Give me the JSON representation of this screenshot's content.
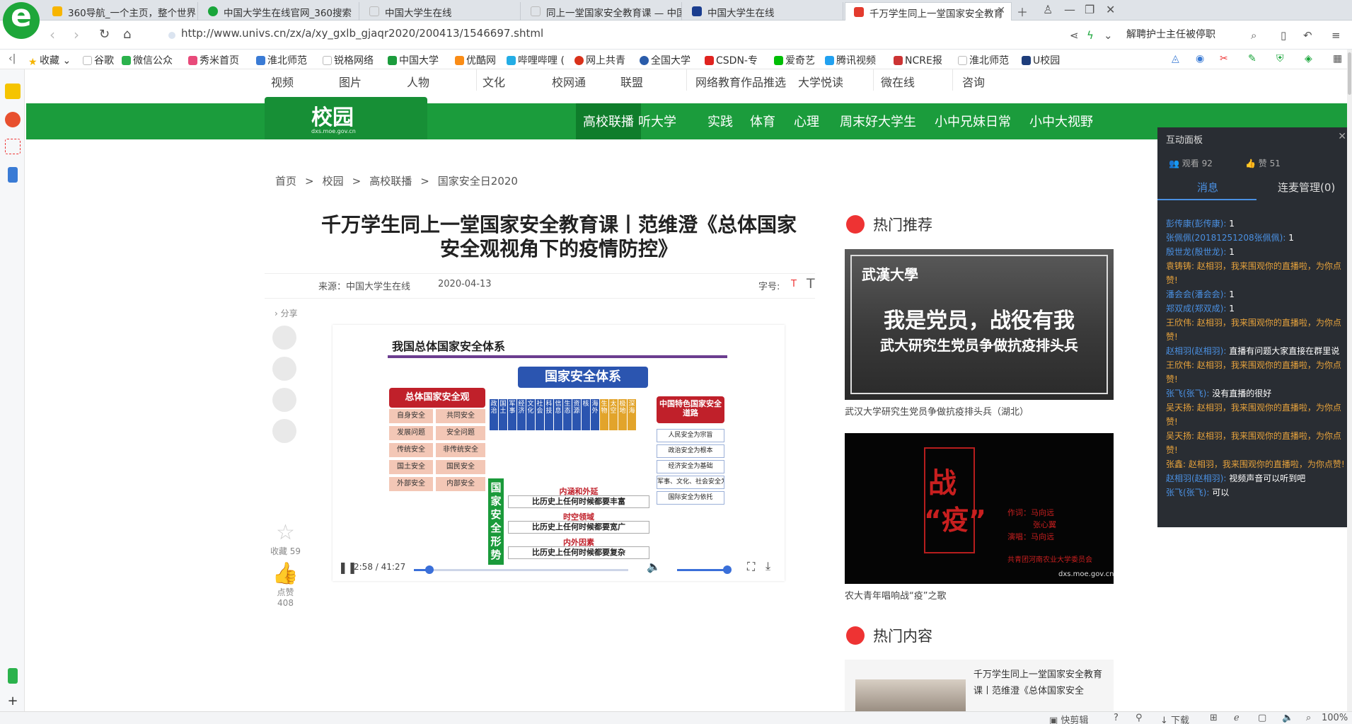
{
  "tabs": [
    {
      "title": "360导航_一个主页，整个世界",
      "color": "#f7b500"
    },
    {
      "title": "中国大学生在线官网_360搜索",
      "color": "#19a53a"
    },
    {
      "title": "中国大学生在线",
      "color": "#bbbbbb"
    },
    {
      "title": "同上一堂国家安全教育课 — 中国",
      "color": "#bbbbbb"
    },
    {
      "title": "中国大学生在线",
      "color": "#1a3d8f"
    },
    {
      "title": "千万学生同上一堂国家安全教育",
      "color": "#e33b2e"
    }
  ],
  "address": {
    "url": "http://www.univs.cn/zx/a/xy_gxlb_gjaqr2020/200413/1546697.shtml",
    "search": "解聘护士主任被停职"
  },
  "bookmarks": [
    "收藏",
    "谷歌",
    "微信公众",
    "秀米首页",
    "淮北师范",
    "锐格网络",
    "中国大学",
    "优酷网",
    "哔哩哔哩 (",
    "网上共青",
    "全国大学",
    "CSDN-专",
    "爱奇艺",
    "腾讯视频",
    "NCRE报",
    "淮北师范",
    "U校园"
  ],
  "site": {
    "topnav": [
      "视频",
      "图片",
      "人物",
      "文化",
      "校网通",
      "联盟",
      "网络教育作品推选",
      "大学悦读",
      "微在线",
      "咨询"
    ],
    "campus": {
      "title": "校园",
      "url": "dxs.moe.gov.cn"
    },
    "greennav": [
      "高校联播",
      "听大学",
      "实践",
      "体育",
      "心理",
      "周末好大学生",
      "小中兄妹日常",
      "小中大视野"
    ]
  },
  "breadcrumb": [
    "首页",
    ">",
    "校园",
    ">",
    "高校联播",
    ">",
    "国家安全日2020"
  ],
  "article": {
    "title": "千万学生同上一堂国家安全教育课丨范维澄《总体国家安全观视角下的疫情防控》",
    "source": "来源：中国大学生在线",
    "date": "2020-04-13",
    "font_label": "字号:",
    "share_label": "分享",
    "fav_label": "收藏 59",
    "like_label": "点赞",
    "like_count": "408"
  },
  "video": {
    "time": "2:58 / 41:27",
    "progress": 0.072,
    "volume": 1.0,
    "slide": {
      "heading": "我国总体国家安全体系",
      "system": "国家安全体系",
      "left_head": "总体国家安全观",
      "left_pairs": [
        [
          "自身安全",
          "共同安全"
        ],
        [
          "发展问题",
          "安全问题"
        ],
        [
          "传统安全",
          "非传统安全"
        ],
        [
          "国土安全",
          "国民安全"
        ],
        [
          "外部安全",
          "内部安全"
        ]
      ],
      "cols": [
        "政治",
        "国土",
        "军事",
        "经济",
        "文化",
        "社会",
        "科技",
        "信息",
        "生态",
        "资源",
        "核",
        "海外",
        "生物",
        "太空",
        "极地",
        "深海"
      ],
      "right_head": "中国特色国家安全道路",
      "right_items": [
        "人民安全为宗旨",
        "政治安全为根本",
        "经济安全为基础",
        "军事、文化、社会安全为保障",
        "国际安全为依托"
      ],
      "situation": "国家安全形势",
      "mid": [
        [
          "内涵和外延",
          "比历史上任何时候都要丰富"
        ],
        [
          "时空领域",
          "比历史上任何时候都要宽广"
        ],
        [
          "内外因素",
          "比历史上任何时候都要复杂"
        ]
      ]
    }
  },
  "hot": {
    "title": "热门推荐",
    "items": [
      {
        "caption": "武汉大学研究生党员争做抗疫排头兵（湖北）",
        "uni": "武漢大學",
        "l1": "我是党员，战役有我",
        "l2": "武大研究生党员争做抗疫排头兵"
      },
      {
        "caption": "农大青年唱响战“疫”之歌",
        "big1": "战",
        "big2": "“疫”",
        "credits": [
          "作词：马向远",
          "张心翼",
          "演唱：马向远"
        ],
        "org": "共青团河南农业大学委员会",
        "url": "dxs.moe.gov.cn"
      }
    ]
  },
  "hot_content": {
    "title": "热门内容",
    "text": "千万学生同上一堂国家安全教育课丨范维澄《总体国家安全"
  },
  "panel": {
    "title": "互动面板",
    "viewers": "观看 92",
    "likes": "赞 51",
    "tab_msg": "消息",
    "tab_mic": "连麦管理(0)",
    "messages": [
      {
        "name": "彭传康(彭传康):",
        "text": "1",
        "o": false
      },
      {
        "name": "张佩佩(20181251208张佩佩):",
        "text": "1",
        "o": false
      },
      {
        "name": "殷世龙(殷世龙):",
        "text": "1",
        "o": false
      },
      {
        "name": "袁铸铸:",
        "text": "赵相羽，我来围观你的直播啦，为你点赞!",
        "o": true
      },
      {
        "name": "潘会会(潘会会):",
        "text": "1",
        "o": false
      },
      {
        "name": "郑双成(郑双成):",
        "text": "1",
        "o": false
      },
      {
        "name": "王欣伟:",
        "text": "赵相羽，我来围观你的直播啦，为你点赞!",
        "o": true
      },
      {
        "name": "赵相羽(赵相羽):",
        "text": "直播有问题大家直接在群里说",
        "o": false
      },
      {
        "name": "王欣伟:",
        "text": "赵相羽，我来围观你的直播啦，为你点赞!",
        "o": true
      },
      {
        "name": "张飞(张飞):",
        "text": "没有直播的很好",
        "o": false
      },
      {
        "name": "吴天扬:",
        "text": "赵相羽，我来围观你的直播啦，为你点赞!",
        "o": true
      },
      {
        "name": "吴天扬:",
        "text": "赵相羽，我来围观你的直播啦，为你点赞!",
        "o": true
      },
      {
        "name": "张鑫:",
        "text": "赵相羽，我来围观你的直播啦，为你点赞!",
        "o": true
      },
      {
        "name": "赵相羽(赵相羽):",
        "text": "视频声音可以听到吧",
        "o": false
      },
      {
        "name": "张飞(张飞):",
        "text": "可以",
        "o": false
      }
    ]
  },
  "status": {
    "clip": "快剪辑",
    "download": "下载",
    "zoom": "100%"
  }
}
